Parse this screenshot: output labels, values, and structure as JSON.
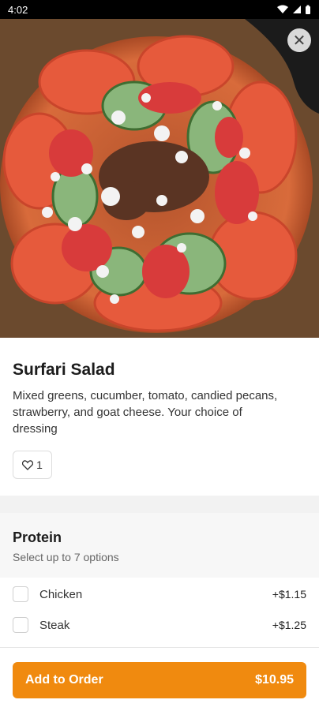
{
  "status": {
    "time": "4:02"
  },
  "item": {
    "title": "Surfari Salad",
    "description": "Mixed greens, cucumber, tomato, candied pecans, strawberry, and goat cheese. Your choice of dressing",
    "likes": "1"
  },
  "protein_section": {
    "title": "Protein",
    "subtitle": "Select up to 7 options",
    "options": [
      {
        "label": "Chicken",
        "price": "+$1.15"
      },
      {
        "label": "Steak",
        "price": "+$1.25"
      }
    ]
  },
  "footer": {
    "button_label": "Add to Order",
    "price": "$10.95"
  },
  "colors": {
    "accent": "#f08a0f"
  }
}
